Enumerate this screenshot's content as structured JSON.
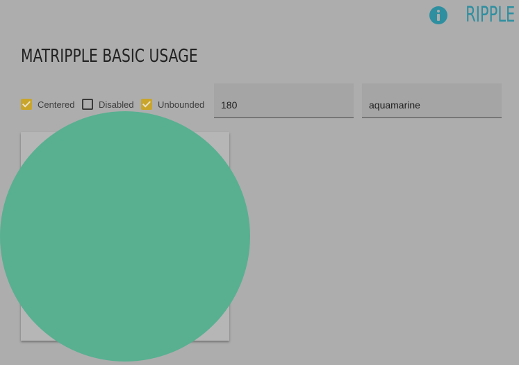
{
  "header": {
    "badge_icon": "info-icon",
    "badge_label": "RIPPLE",
    "accent_color": "#2e8fa0"
  },
  "main": {
    "title": "MATRIPPLE BASIC USAGE"
  },
  "controls": {
    "centered": {
      "label": "Centered",
      "checked": true
    },
    "disabled": {
      "label": "Disabled",
      "checked": false
    },
    "unbounded": {
      "label": "Unbounded",
      "checked": true
    },
    "radius": {
      "value": "180"
    },
    "color": {
      "value": "aquamarine"
    },
    "checkbox_color": "#c9a52b"
  },
  "demo": {
    "ripple_color": "#58b091",
    "ripple_radius": 180
  }
}
